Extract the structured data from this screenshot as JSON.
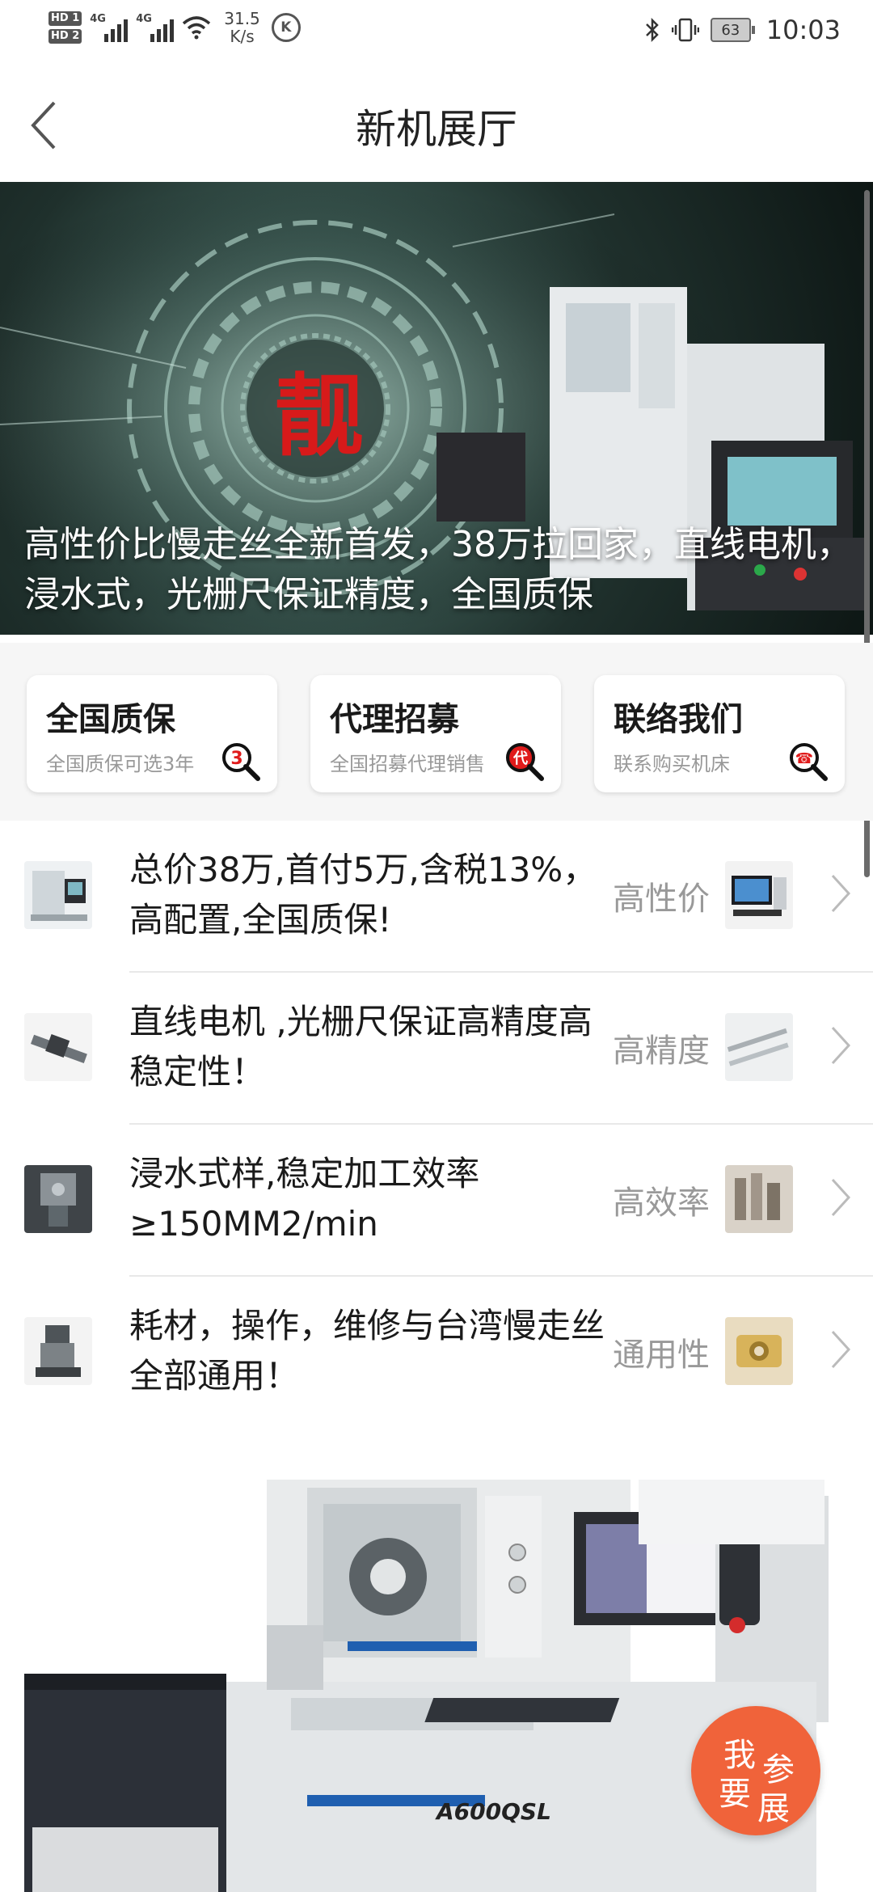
{
  "status_bar": {
    "hd1": "HD 1",
    "hd2": "HD 2",
    "net1": "4G",
    "net2": "4G",
    "speed_value": "31.5",
    "speed_unit": "K/s",
    "k_badge": "K",
    "battery": "63",
    "time": "10:03"
  },
  "nav": {
    "title": "新机展厅"
  },
  "banner": {
    "emblem_char": "靓",
    "caption": "高性价比慢走丝全新首发，38万拉回家，直线电机，浸水式，光栅尺保证精度，全国质保"
  },
  "cards": [
    {
      "title": "全国质保",
      "subtitle": "全国质保可选3年",
      "icon_glyph": "3",
      "icon": "magnifier-3-icon"
    },
    {
      "title": "代理招募",
      "subtitle": "全国招募代理销售",
      "icon_glyph": "代",
      "icon": "magnifier-agent-icon"
    },
    {
      "title": "联络我们",
      "subtitle": "联系购买机床",
      "icon_glyph": "☎",
      "icon": "magnifier-phone-icon"
    }
  ],
  "features": [
    {
      "text": "总价38万,首付5万,含税13%，高配置,全国质保!",
      "tag": "高性价"
    },
    {
      "text": "直线电机 ,光栅尺保证高精度高稳定性！",
      "tag": "高精度"
    },
    {
      "text": "浸水式样,稳定加工效率≥150MM2/min",
      "tag": "高效率"
    },
    {
      "text": "耗材，操作，维修与台湾慢走丝全部通用！",
      "tag": "通用性"
    }
  ],
  "machine": {
    "model_label": "A600QSL"
  },
  "fab": {
    "chars": [
      "我",
      "参",
      "要",
      "展"
    ]
  },
  "colors": {
    "accent": "#f0633a",
    "emblem_red": "#d71a1a",
    "tag_gray": "#999999"
  }
}
